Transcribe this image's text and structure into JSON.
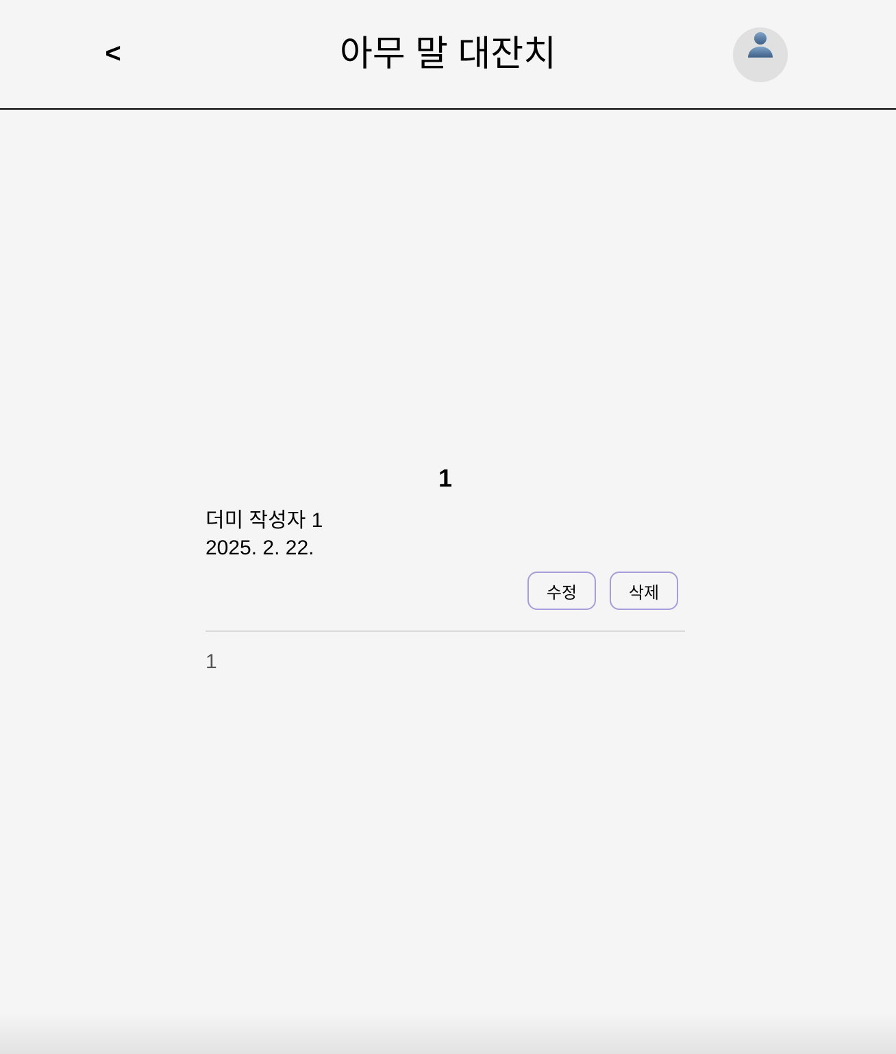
{
  "header": {
    "back_label": "<",
    "title": "아무 말 대잔치",
    "avatar_icon": "user-avatar-icon"
  },
  "post": {
    "title": "1",
    "author": "더미 작성자 1",
    "date": "2025. 2. 22.",
    "edit_label": "수정",
    "delete_label": "삭제",
    "body": "1"
  },
  "colors": {
    "background": "#f5f5f5",
    "button_border": "#a59ddc",
    "avatar_bg": "#e0e0e0",
    "divider": "#d9d9d9",
    "body_text": "#555555"
  }
}
